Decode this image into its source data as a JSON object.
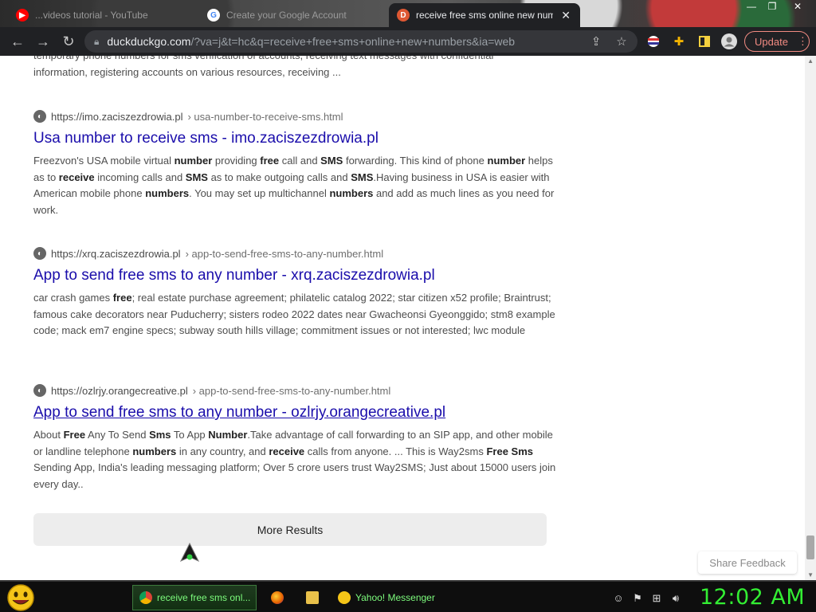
{
  "browser": {
    "tabs": [
      {
        "label": "...videos tutorial - YouTube",
        "active": false
      },
      {
        "label": "Create your Google Account",
        "active": false
      },
      {
        "label": "receive free sms online new num",
        "active": true
      }
    ],
    "tab_close": "✕",
    "window_controls": [
      "—",
      "❐",
      "✕"
    ],
    "url_host": "duckduckgo.com",
    "url_path": "/?va=j&t=hc&q=receive+free+sms+online+new+numbers&ia=web",
    "update_label": "Update",
    "colors": {
      "chrome": "#202124",
      "update": "#f28b82"
    }
  },
  "page": {
    "partial_snippet_top": "temporary phone numbers for sms verification of accounts, receiving text messages with confidential",
    "partial_snippet_bottom": "information, registering accounts on various resources, receiving ...",
    "results": [
      {
        "domain": "https://imo.zaciszezdrowia.pl",
        "crumb": "› usa-number-to-receive-sms.html",
        "title": "Usa number to receive sms - imo.zaciszezdrowia.pl",
        "snippet_html": "Freezvon's USA mobile virtual <b>number</b> providing <b>free</b> call and <b>SMS</b> forwarding. This kind of phone <b>number</b> helps as to <b>receive</b> incoming calls and <b>SMS</b> as to make outgoing calls and <b>SMS</b>.Having business in USA is easier with American mobile phone <b>numbers</b>. You may set up multichannel <b>numbers</b> and add as much lines as you need for work."
      },
      {
        "domain": "https://xrq.zaciszezdrowia.pl",
        "crumb": "› app-to-send-free-sms-to-any-number.html",
        "title": "App to send free sms to any number - xrq.zaciszezdrowia.pl",
        "snippet_html": "car crash games <b>free</b>; real estate purchase agreement; philatelic catalog 2022; star citizen x52 profile; Braintrust; famous cake decorators near Puducherry; sisters rodeo 2022 dates near Gwacheonsi Gyeonggido; stm8 example code; mack em7 engine specs; subway south hills village; commitment issues or not interested; lwc module"
      },
      {
        "domain": "https://ozlrjy.orangecreative.pl",
        "crumb": "› app-to-send-free-sms-to-any-number.html",
        "title": "App to send free sms to any number - ozlrjy.orangecreative.pl",
        "snippet_html": "About <b>Free</b> Any To Send <b>Sms</b> To App <b>Number</b>.Take advantage of call forwarding to an SIP app, and other mobile or landline telephone <b>numbers</b> in any country, and <b>receive</b> calls from anyone. ... This is Way2sms <b>Free Sms</b> Sending App, India's leading messaging platform; Over 5 crore users trust Way2SMS; Just about 15000 users join every day.."
      }
    ],
    "more_results": "More Results",
    "share_feedback": "Share Feedback",
    "link_color": "#1a0dab"
  },
  "taskbar": {
    "tasks": [
      {
        "label": "receive free sms onl...",
        "icon": "chrome-icon",
        "active": true
      },
      {
        "label": "",
        "icon": "firefox-icon",
        "active": false
      },
      {
        "label": "",
        "icon": "folder-icon",
        "active": false
      },
      {
        "label": "Yahoo! Messenger",
        "icon": "yahoo-messenger-icon",
        "active": false
      }
    ],
    "clock": "12:02 AM",
    "clock_color": "#33ee33"
  }
}
